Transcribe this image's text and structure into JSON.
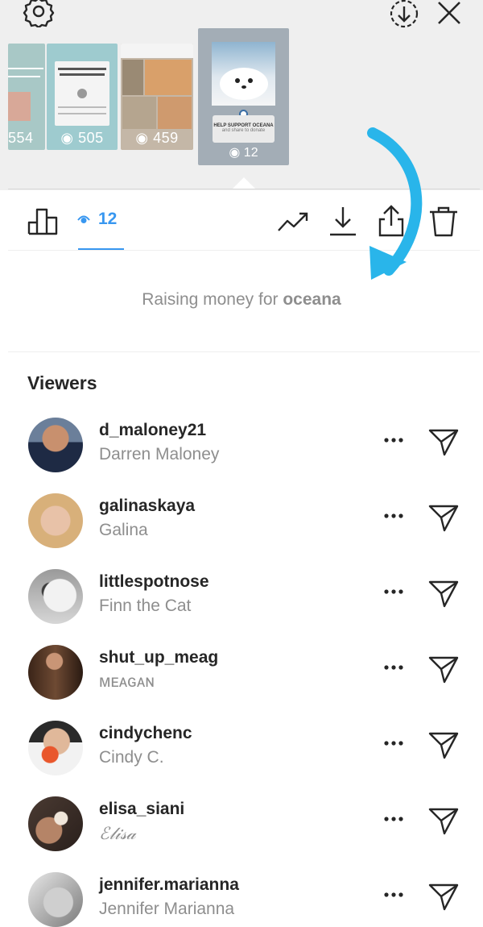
{
  "stories": {
    "thumbnails": [
      {
        "count": "554"
      },
      {
        "count": "505"
      },
      {
        "count": "459"
      }
    ],
    "selected": {
      "count": "12",
      "card_title": "HELP SUPPORT OCEANA",
      "card_sub": "and share to donate"
    }
  },
  "actions": {
    "views_count": "12"
  },
  "fundraiser": {
    "prefix": "Raising money for ",
    "org": "oceana"
  },
  "viewers": {
    "title": "Viewers",
    "list": [
      {
        "username": "d_maloney21",
        "full_name": "Darren Maloney"
      },
      {
        "username": "galinaskaya",
        "full_name": "Galina"
      },
      {
        "username": "littlespotnose",
        "full_name": "Finn the Cat"
      },
      {
        "username": "shut_up_meag",
        "full_name": "ᴍᴇᴀɢᴀɴ"
      },
      {
        "username": "cindychenc",
        "full_name": "Cindy C."
      },
      {
        "username": "elisa_siani",
        "full_name": "ℰ𝓁𝒾𝓈𝒶"
      },
      {
        "username": "jennifer.marianna",
        "full_name": "Jennifer Marianna"
      }
    ]
  },
  "colors": {
    "accent_blue": "#3897f0",
    "annotation_arrow": "#29b5ea",
    "secondary_text": "#8e8e8e",
    "primary_text": "#262626"
  },
  "icons": [
    "gear-icon",
    "save-icon",
    "close-icon",
    "insights-icon",
    "eye-icon",
    "trending-icon",
    "download-icon",
    "share-icon",
    "trash-icon",
    "more-icon",
    "send-icon"
  ]
}
